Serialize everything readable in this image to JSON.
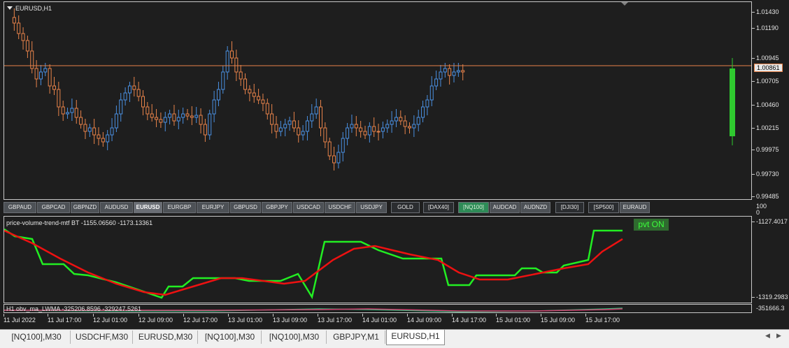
{
  "chart": {
    "symbol_title": "EURUSD,H1",
    "current_price": "1.00861",
    "price_labels": [
      "1.01430",
      "1.01190",
      "1.00945",
      "1.00705",
      "1.00460",
      "1.00215",
      "0.99975",
      "0.99730",
      "0.99485"
    ],
    "price_line_value": "1.00861",
    "colors": {
      "up": "#4a90e2",
      "down": "#e8834a",
      "price_line": "#e8834a",
      "volume_bar": "#2fc92f"
    }
  },
  "symbol_buttons": [
    {
      "label": "GBPAUD"
    },
    {
      "label": "GBPCAD"
    },
    {
      "label": "GBPNZD"
    },
    {
      "label": "AUDUSD"
    },
    {
      "label": "EURUSD"
    },
    {
      "label": "EURGBP"
    },
    {
      "label": "EURJPY"
    },
    {
      "label": "GBPUSD"
    },
    {
      "label": "GBPJPY"
    },
    {
      "label": "USDCAD"
    },
    {
      "label": "USDCHF"
    },
    {
      "label": "USDJPY"
    },
    {
      "label": "GOLD"
    },
    {
      "label": "[DAX40]"
    },
    {
      "label": "[NQ100]"
    },
    {
      "label": "AUDCAD"
    },
    {
      "label": "AUDNZD"
    },
    {
      "label": "[DJI30]"
    },
    {
      "label": "[SP500]"
    },
    {
      "label": "EURAUD"
    }
  ],
  "symbol_axis_labels": [
    "100",
    "0"
  ],
  "indicator1": {
    "title": "price-volume-trend-mtf BT -1155.06560 -1173.13361",
    "axis_top": "-1127.4017",
    "axis_bottom": "-1319.2983",
    "button_label": "pvt ON",
    "colors": {
      "fast": "#22ee22",
      "slow": "#ee1111"
    }
  },
  "indicator2": {
    "title": "H1 obv_ma_LWMA -325206.8596 -329247.5261",
    "axis_label": "-351666.3",
    "colors": {
      "a": "#2ec27e",
      "b": "#d04070"
    }
  },
  "time_labels": [
    "11 Jul 2022",
    "11 Jul 17:00",
    "12 Jul 01:00",
    "12 Jul 09:00",
    "12 Jul 17:00",
    "13 Jul 01:00",
    "13 Jul 09:00",
    "13 Jul 17:00",
    "14 Jul 01:00",
    "14 Jul 09:00",
    "14 Jul 17:00",
    "15 Jul 01:00",
    "15 Jul 09:00",
    "15 Jul 17:00"
  ],
  "tabs": [
    {
      "label": "[NQ100],M30",
      "active": false
    },
    {
      "label": "USDCHF,M30",
      "active": false
    },
    {
      "label": "EURUSD,M30",
      "active": false
    },
    {
      "label": "[NQ100],M30",
      "active": false
    },
    {
      "label": "[NQ100],M30",
      "active": false
    },
    {
      "label": "GBPJPY,M1",
      "active": false
    },
    {
      "label": "EURUSD,H1",
      "active": true
    }
  ]
}
